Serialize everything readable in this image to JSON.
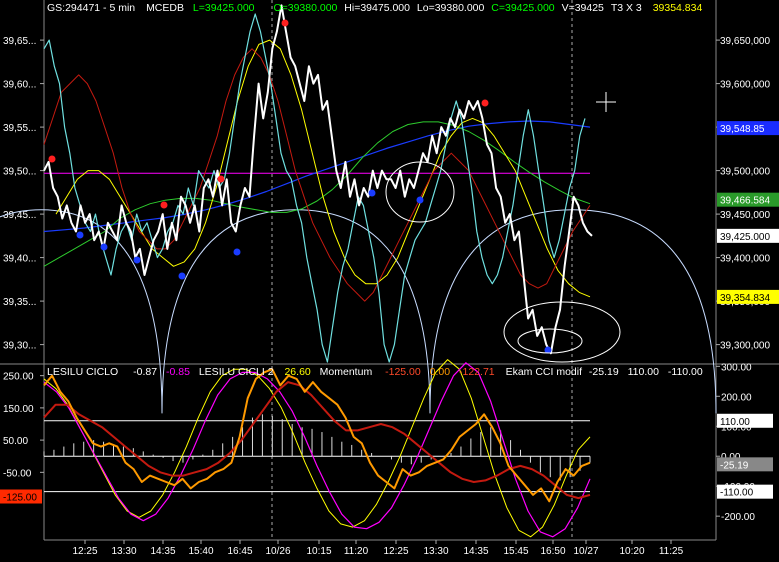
{
  "header": {
    "symbol": "GS:294471 - 5 min",
    "exchange": "MCEDB",
    "last": "L=39425.000",
    "open": "O=39380.000",
    "high": "Hi=39475.000",
    "low": "Lo=39380.000",
    "close": "C=39425.000",
    "volume": "V=39425",
    "ticks": "T3 X 3",
    "value": "39354.834"
  },
  "lower_header": {
    "ciclo_name": "LESILU CICLO",
    "ciclo_val": "-0.87",
    "ciclo_val2": "-0.85",
    "ciclo2_name": "LESILU CICLI 2",
    "ciclo2_val": "26.60",
    "momentum_name": "Momentum",
    "momentum_vals": [
      "-125.00",
      "0.00",
      "-122.71"
    ],
    "cci_name": "Ekam CCI modif",
    "cci_vals": [
      "-25.19",
      "110.00",
      "-110.00"
    ]
  },
  "colors": {
    "price": "#ffffff",
    "cyan": "#6fe0e0",
    "red": "#c41a10",
    "yellow": "#ffff00",
    "green": "#2ecc2e",
    "blue": "#1a3cff",
    "magenta": "#ff00ff",
    "orange": "#ff9a00",
    "arc": "#c8dcff",
    "dot_red": "#ff2020",
    "dot_blue": "#1a3cff"
  },
  "chart_data": [
    {
      "type": "line",
      "panel": "price",
      "y_left_ticks": [
        "39,65...",
        "39,60...",
        "39,55...",
        "39,50...",
        "39,45...",
        "39,40...",
        "39,35...",
        "39,30..."
      ],
      "y_right_ticks": [
        "39,650,000",
        "39,600,000",
        "39,550,000",
        "39,500,000",
        "39,450,000",
        "39,400,000",
        "39,350,000",
        "39,300,000"
      ],
      "ylim": [
        39280,
        39680
      ],
      "price_tags": [
        {
          "label": "39,466.584",
          "value": 39466.584,
          "bg": "#2a9a2a",
          "fg": "#ffffff"
        },
        {
          "label": "39,425.000",
          "value": 39425,
          "bg": "#ffffff",
          "fg": "#000000"
        },
        {
          "label": "39,354.834",
          "value": 39354.834,
          "bg": "#ffff00",
          "fg": "#000000"
        },
        {
          "label": "39,548.85",
          "value": 39548.85,
          "bg": "#1a2cff",
          "fg": "#ffffff"
        }
      ],
      "hline_magenta": 39497,
      "series": [
        {
          "key": "price",
          "values": [
            39500,
            39510,
            39480,
            39470,
            39445,
            39460,
            39440,
            39430,
            39460,
            39440,
            39450,
            39420,
            39430,
            39410,
            39440,
            39430,
            39420,
            39460,
            39440,
            39430,
            39400,
            39410,
            39380,
            39400,
            39420,
            39430,
            39450,
            39410,
            39440,
            39420,
            39470,
            39460,
            39440,
            39460,
            39430,
            39480,
            39490,
            39470,
            39500,
            39460,
            39490,
            39440,
            39430,
            39460,
            39480,
            39470,
            39540,
            39600,
            39560,
            39590,
            39640,
            39660,
            39690,
            39660,
            39630,
            39620,
            39600,
            39580,
            39620,
            39600,
            39610,
            39570,
            39580,
            39540,
            39500,
            39480,
            39510,
            39470,
            39490,
            39460,
            39480,
            39470,
            39500,
            39480,
            39500,
            39490,
            39490,
            39480,
            39500,
            39470,
            39490,
            39480,
            39500,
            39520,
            39510,
            39540,
            39520,
            39550,
            39540,
            39560,
            39550,
            39570,
            39560,
            39580,
            39570,
            39580,
            39560,
            39530,
            39520,
            39480,
            39470,
            39440,
            39450,
            39420,
            39430,
            39380,
            39330,
            39340,
            39310,
            39320,
            39300,
            39290,
            39320,
            39340,
            39390,
            39430,
            39470,
            39460,
            39440,
            39430,
            39425
          ]
        },
        {
          "key": "cyan",
          "values": [
            39640,
            39650,
            39620,
            39600,
            39550,
            39520,
            39480,
            39460,
            39440,
            39430,
            39450,
            39420,
            39400,
            39380,
            39410,
            39430,
            39440,
            39420,
            39450,
            39430,
            39440,
            39420,
            39400,
            39410,
            39430,
            39440,
            39460,
            39450,
            39480,
            39460,
            39500,
            39490,
            39480,
            39500,
            39480,
            39490,
            39520,
            39560,
            39600,
            39630,
            39660,
            39680,
            39660,
            39630,
            39600,
            39560,
            39520,
            39500,
            39490,
            39460,
            39440,
            39400,
            39370,
            39340,
            39300,
            39280,
            39320,
            39360,
            39390,
            39410,
            39440,
            39470,
            39460,
            39430,
            39400,
            39360,
            39300,
            39280,
            39300,
            39340,
            39380,
            39400,
            39420,
            39430,
            39440,
            39460,
            39480,
            39500,
            39530,
            39560,
            39580,
            39560,
            39520,
            39480,
            39430,
            39400,
            39380,
            39370,
            39380,
            39400,
            39430,
            39460,
            39500,
            39540,
            39570,
            39540,
            39500,
            39460,
            39420,
            39400,
            39420,
            39450,
            39480,
            39500,
            39540,
            39560
          ]
        },
        {
          "key": "red",
          "values": [
            39530,
            39560,
            39590,
            39600,
            39610,
            39600,
            39580,
            39550,
            39520,
            39480,
            39450,
            39430,
            39420,
            39410,
            39410,
            39420,
            39440,
            39460,
            39480,
            39510,
            39540,
            39580,
            39610,
            39630,
            39640,
            39630,
            39610,
            39580,
            39540,
            39500,
            39470,
            39440,
            39420,
            39400,
            39385,
            39370,
            39360,
            39350,
            39360,
            39380,
            39400,
            39420,
            39440,
            39460,
            39480,
            39500,
            39510,
            39520,
            39510,
            39500,
            39480,
            39460,
            39440,
            39420,
            39400,
            39380,
            39370,
            39365,
            39370,
            39390,
            39410,
            39430,
            39445,
            39460
          ]
        },
        {
          "key": "yellow",
          "values": [
            39450,
            39470,
            39490,
            39500,
            39500,
            39490,
            39470,
            39450,
            39430,
            39410,
            39400,
            39390,
            39395,
            39410,
            39440,
            39480,
            39530,
            39580,
            39620,
            39645,
            39650,
            39640,
            39610,
            39570,
            39520,
            39470,
            39430,
            39400,
            39380,
            39370,
            39370,
            39380,
            39400,
            39430,
            39460,
            39490,
            39520,
            39540,
            39555,
            39560,
            39555,
            39540,
            39520,
            39500,
            39470,
            39440,
            39410,
            39385,
            39370,
            39360,
            39355
          ]
        },
        {
          "key": "green",
          "values": [
            39390,
            39400,
            39410,
            39420,
            39430,
            39445,
            39455,
            39462,
            39466,
            39468,
            39468,
            39466,
            39462,
            39458,
            39455,
            39452,
            39452,
            39456,
            39465,
            39478,
            39495,
            39515,
            39532,
            39545,
            39553,
            39556,
            39556,
            39552,
            39545,
            39535,
            39523,
            39510,
            39498,
            39487,
            39477,
            39468,
            39462
          ]
        },
        {
          "key": "blue",
          "values": [
            39430,
            39432,
            39434,
            39437,
            39440,
            39443,
            39446,
            39450,
            39455,
            39461,
            39468,
            39476,
            39485,
            39494,
            39502,
            39510,
            39518,
            39526,
            39533,
            39540,
            39546,
            39551,
            39554,
            39556,
            39557,
            39556,
            39553,
            39550
          ]
        }
      ]
    },
    {
      "type": "line",
      "panel": "oscillator",
      "y_left_ticks": [
        "250.00",
        "150.00",
        "50.00",
        "-50.00"
      ],
      "y_right_ticks": [
        "300.00",
        "200.00",
        "100.00",
        "0.00",
        "-100.00",
        "-200.00"
      ],
      "ylim": [
        -260,
        280
      ],
      "hlines": [
        110,
        0,
        -110
      ],
      "value_tags": [
        {
          "label": "110.00",
          "value": 110,
          "bg": "#ffffff",
          "fg": "#000000"
        },
        {
          "label": "-25.19",
          "value": -25.19,
          "bg": "#888888",
          "fg": "#ffffff"
        },
        {
          "label": "-110.00",
          "value": -110,
          "bg": "#ffffff",
          "fg": "#000000"
        },
        {
          "label": "-125.00",
          "value": -125,
          "bg": "#ff2a00",
          "fg": "#000000"
        }
      ],
      "series": [
        {
          "key": "orange",
          "values": [
            220,
            250,
            200,
            170,
            120,
            80,
            40,
            30,
            40,
            30,
            -20,
            -40,
            -80,
            -60,
            -70,
            -80,
            -90,
            -70,
            -100,
            -80,
            -70,
            -50,
            -40,
            -20,
            60,
            180,
            240,
            260,
            270,
            220,
            250,
            240,
            200,
            230,
            200,
            180,
            160,
            120,
            60,
            40,
            -20,
            -60,
            -80,
            -100,
            -40,
            -60,
            -50,
            -30,
            -20,
            -10,
            20,
            60,
            80,
            100,
            130,
            90,
            40,
            -30,
            -60,
            -90,
            -120,
            -100,
            -140,
            -80,
            -40,
            -60,
            -30,
            -20
          ]
        },
        {
          "key": "red",
          "values": [
            120,
            160,
            160,
            130,
            110,
            90,
            60,
            30,
            0,
            -30,
            -50,
            -60,
            -60,
            -50,
            -40,
            -20,
            10,
            50,
            100,
            150,
            200,
            230,
            220,
            190,
            150,
            110,
            80,
            80,
            90,
            100,
            90,
            70,
            40,
            10,
            -20,
            -50,
            -70,
            -80,
            -75,
            -60,
            -40,
            -30,
            -40,
            -60,
            -90,
            -120,
            -130,
            -120
          ]
        },
        {
          "key": "yellow",
          "values": [
            240,
            210,
            160,
            90,
            20,
            -50,
            -120,
            -170,
            -190,
            -170,
            -120,
            -50,
            30,
            120,
            200,
            250,
            270,
            270,
            250,
            210,
            150,
            70,
            -20,
            -100,
            -170,
            -210,
            -220,
            -200,
            -150,
            -80,
            0,
            90,
            180,
            260,
            300,
            270,
            180,
            60,
            -60,
            -160,
            -230,
            -250,
            -220,
            -150,
            -60,
            20,
            60
          ]
        },
        {
          "key": "magenta",
          "values": [
            230,
            200,
            150,
            80,
            10,
            -60,
            -130,
            -180,
            -200,
            -180,
            -130,
            -60,
            20,
            110,
            190,
            240,
            260,
            260,
            240,
            200,
            140,
            60,
            -30,
            -110,
            -180,
            -220,
            -225,
            -205,
            -160,
            -90,
            -10,
            80,
            170,
            250,
            290,
            260,
            170,
            50,
            -70,
            -170,
            -235,
            -250,
            -225,
            -160,
            -70
          ]
        },
        {
          "key": "histogram",
          "values": [
            30,
            40,
            60,
            80,
            90,
            100,
            90,
            70,
            60,
            50,
            30,
            10,
            -10,
            -30,
            -40,
            -20,
            10,
            40,
            80,
            120,
            180,
            240,
            260,
            250,
            230,
            200,
            180,
            170,
            150,
            120,
            90,
            70,
            40,
            20,
            0,
            -20,
            -40,
            -50,
            -40,
            -20,
            0,
            20,
            60,
            110,
            150,
            180,
            160,
            100,
            40,
            -40,
            -100,
            -130,
            -150,
            -130,
            -90,
            -40
          ]
        }
      ]
    }
  ],
  "x_axis": {
    "ticks": [
      "12:25",
      "13:30",
      "14:35",
      "15:40",
      "16:45",
      "10/26",
      "10:15",
      "11:20",
      "12:25",
      "13:30",
      "14:35",
      "15:45",
      "16:50",
      "10/27",
      "10:20",
      "11:25"
    ]
  }
}
